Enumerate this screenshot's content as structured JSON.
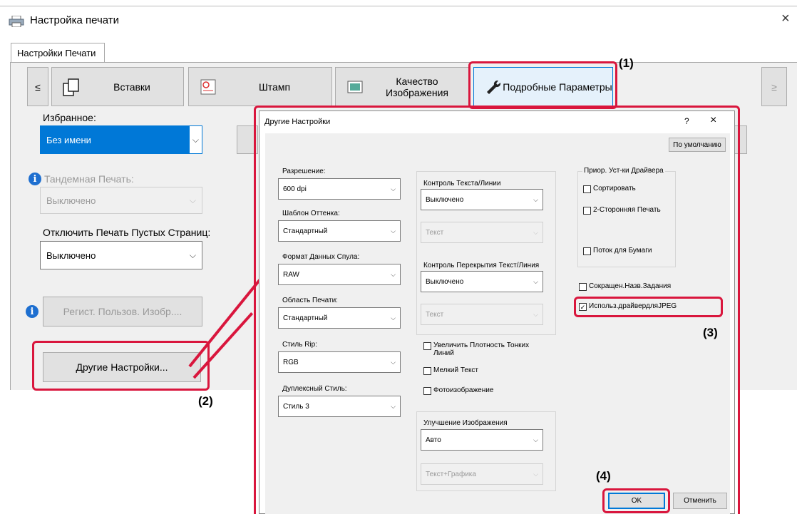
{
  "window": {
    "title": "Настройка печати",
    "close_glyph": "×",
    "icon": "printer-icon"
  },
  "tab": {
    "label": "Настройки Печати"
  },
  "nav": {
    "prev": "≤",
    "next": "≥",
    "buttons": [
      {
        "label": "Вставки",
        "icon": "inserts-icon"
      },
      {
        "label": "Штамп",
        "icon": "stamp-icon"
      },
      {
        "label": "Качество Изображения",
        "icon": "image-quality-icon"
      },
      {
        "label": "Подробные Параметры",
        "icon": "wrench-icon"
      }
    ]
  },
  "left": {
    "favorites_label": "Избранное:",
    "favorites_value": "Без имени",
    "tandem_label": "Тандемная Печать:",
    "tandem_value": "Выключено",
    "blank_label": "Отключить Печать Пустых Страниц:",
    "blank_value": "Выключено",
    "register_button": "Регист. Пользов. Изобр....",
    "other_settings_button": "Другие Настройки..."
  },
  "callouts": {
    "c1": "(1)",
    "c2": "(2)",
    "c3": "(3)",
    "c4": "(4)"
  },
  "dialog": {
    "title": "Другие Настройки",
    "help": "?",
    "close": "×",
    "defaults_button": "По умолчанию",
    "resolution_label": "Разрешение:",
    "resolution_value": "600 dpi",
    "pattern_label": "Шаблон Оттенка:",
    "pattern_value": "Стандартный",
    "spool_label": "Формат Данных Спула:",
    "spool_value": "RAW",
    "print_area_label": "Область Печати:",
    "print_area_value": "Стандартный",
    "rip_label": "Стиль Rip:",
    "rip_value": "RGB",
    "duplex_label": "Дуплексный Стиль:",
    "duplex_value": "Стиль 3",
    "text_line_label": "Контроль Текста/Линии",
    "text_line_value": "Выключено",
    "text_line_sub": "Текст",
    "overlap_label": "Контроль Перекрытия Текст/Линия",
    "overlap_value": "Выключено",
    "overlap_sub": "Текст",
    "thin_lines": "Увеличить Плотность Тонких Линий",
    "small_text": "Мелкий Текст",
    "photo": "Фотоизображение",
    "enhance_label": "Улучшение Изображения",
    "enhance_value": "Авто",
    "enhance_sub": "Текст+Графика",
    "driver_group": "Приор. Уст-ки Драйвера",
    "sort": "Сортировать",
    "two_sided": "2-Сторонняя Печать",
    "paper_flow": "Поток для Бумаги",
    "short_job": "Сокращен.Назв.Задания",
    "jpeg": "Использ.драйвердляJPEG",
    "jpeg_check": "✓",
    "ok": "OK",
    "cancel": "Отменить"
  },
  "colors": {
    "accent": "#0078d7",
    "callout_red": "#d9163d",
    "info_blue": "#1e6fd0"
  }
}
